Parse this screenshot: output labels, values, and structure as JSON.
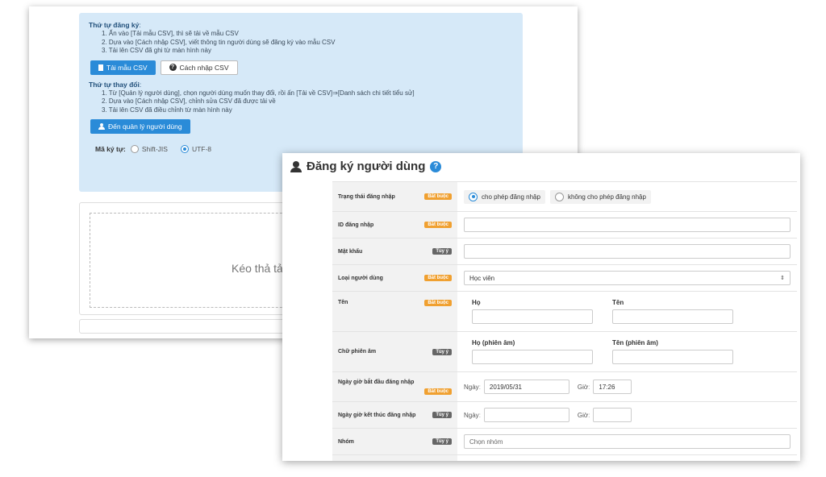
{
  "csv_panel": {
    "register_order_title": "Thứ tự đăng ký",
    "register_steps": [
      "1. Ấn vào [Tải mẫu CSV], thì sẽ tải về mẫu CSV",
      "2. Dựa vào [Cách nhập CSV], viết thông tin người dùng sẽ đăng ký vào mẫu CSV",
      "3. Tải lên CSV đã ghi từ màn hình này"
    ],
    "download_template_label": "Tải mẫu CSV",
    "how_to_input_label": "Cách nhập CSV",
    "change_order_title": "Thứ tự thay đổi",
    "change_steps": [
      "1. Từ [Quản lý người dùng], chọn người dùng muốn thay đổi, rồi ấn [Tải về CSV]⇒[Danh sách chi tiết tiểu sử]",
      "2. Dựa vào [Cách nhập CSV], chỉnh sửa CSV đã được tải về",
      "3. Tải lên CSV đã điều chỉnh từ màn hình này"
    ],
    "goto_user_mgmt_label": "Đến quản lý người dùng",
    "charset_label": "Mã ký tự",
    "charset_options": [
      "Shift-JIS",
      "UTF-8"
    ],
    "charset_selected": "UTF-8",
    "drop_text": "Kéo thả tả"
  },
  "registration": {
    "title": "Đăng ký người dùng",
    "badges": {
      "required": "Bắt buộc",
      "optional": "Tùy ý"
    },
    "login_status": {
      "label": "Trạng thái đăng nhập",
      "options": [
        "cho phép đăng nhập",
        "không cho phép đăng nhập"
      ],
      "selected": "cho phép đăng nhập"
    },
    "login_id": {
      "label": "ID đăng nhập",
      "value": ""
    },
    "password": {
      "label": "Mật khẩu",
      "value": ""
    },
    "user_type": {
      "label": "Loại người dùng",
      "value": "Học viên"
    },
    "name": {
      "label": "Tên",
      "last_label": "Họ",
      "first_label": "Tên",
      "last_value": "",
      "first_value": ""
    },
    "phonetic": {
      "label": "Chữ phiên âm",
      "last_label": "Họ (phiên âm)",
      "first_label": "Tên (phiên âm)",
      "last_value": "",
      "first_value": ""
    },
    "login_start": {
      "label": "Ngày giờ bắt đầu đăng nhập",
      "date_label": "Ngày",
      "time_label": "Giờ",
      "date_value": "2019/05/31",
      "time_value": "17:26"
    },
    "login_end": {
      "label": "Ngày giờ kết thúc đăng nhập",
      "date_label": "Ngày",
      "time_label": "Giờ",
      "date_value": "",
      "time_value": ""
    },
    "group": {
      "label": "Nhóm",
      "placeholder": "Chọn nhóm"
    }
  }
}
